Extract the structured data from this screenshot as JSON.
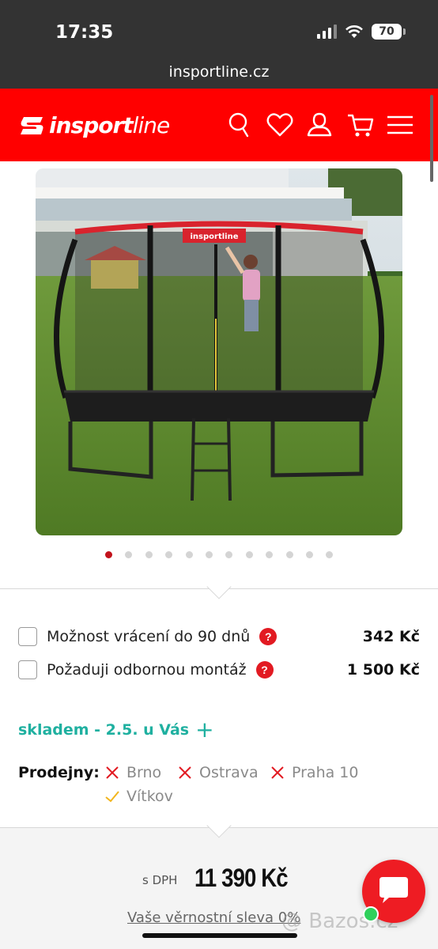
{
  "status_bar": {
    "time": "17:35",
    "battery": "70",
    "url": "insportline.cz"
  },
  "header": {
    "logo_text_bold": "insport",
    "logo_text_rest": "line",
    "icons": [
      "search-icon",
      "heart-icon",
      "user-icon",
      "cart-icon",
      "menu-icon"
    ],
    "brand_color": "#ff0000"
  },
  "gallery": {
    "image": "trampoline-photo",
    "banner_text": "insportline",
    "dot_count": 12,
    "active_index": 0
  },
  "options": [
    {
      "label": "Možnost vrácení do 90 dnů",
      "price": "342 Kč",
      "help": "?"
    },
    {
      "label": "Požaduji odbornou montáž",
      "price": "1 500 Kč",
      "help": "?"
    }
  ],
  "stock": {
    "text": "skladem - 2.5. u Vás",
    "plus": "+",
    "color": "#1fb0a0"
  },
  "stores": {
    "label": "Prodejny:",
    "items": [
      {
        "name": "Brno",
        "available": false
      },
      {
        "name": "Ostrava",
        "available": false
      },
      {
        "name": "Praha 10",
        "available": false
      },
      {
        "name": "Vítkov",
        "available": true
      }
    ]
  },
  "price": {
    "prefix": "s DPH",
    "value": "11 390 Kč",
    "loyalty": "Vaše věrnostní sleva 0%"
  },
  "watermark": "@ Bazos.cz"
}
